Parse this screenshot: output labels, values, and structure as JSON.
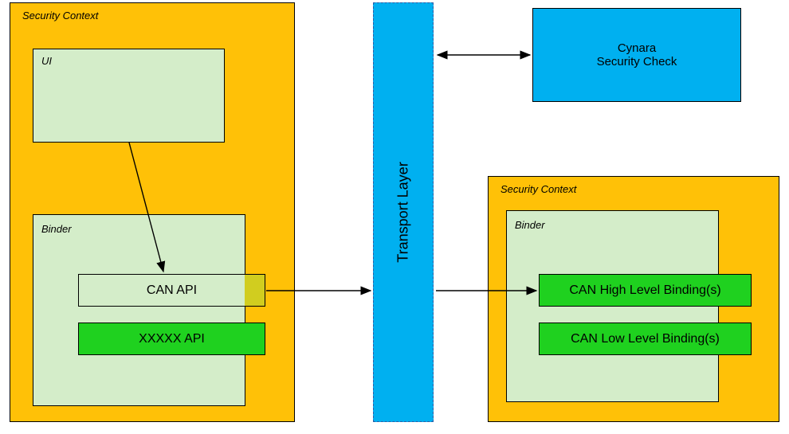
{
  "left": {
    "security_context_label": "Security Context",
    "ui_label": "UI",
    "binder_label": "Binder",
    "can_api_label": "CAN API",
    "xxxxx_api_label": "XXXXX API"
  },
  "transport_layer_label": "Transport  Layer",
  "cynara_line1": "Cynara",
  "cynara_line2": "Security Check",
  "right": {
    "security_context_label": "Security Context",
    "binder_label": "Binder",
    "can_high_label": "CAN High Level Binding(s)",
    "can_low_label": "CAN Low Level Binding(s)"
  },
  "colors": {
    "orange": "#ffc107",
    "light_green": "#d4edc9",
    "bright_green": "#1fd11f",
    "cyan": "#00b0f0",
    "olive": "#d1cd1f"
  }
}
